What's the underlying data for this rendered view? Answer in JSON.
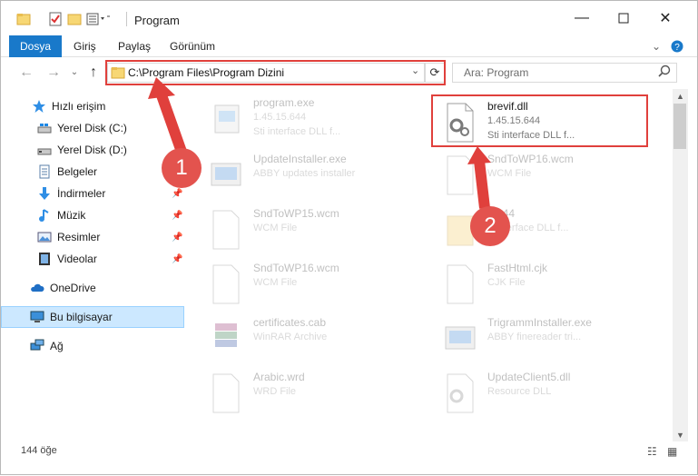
{
  "window": {
    "title": "Program"
  },
  "ribbon": {
    "tabs": [
      "Dosya",
      "Giriş",
      "Paylaş",
      "Görünüm"
    ],
    "help_icon": "question-icon"
  },
  "address": {
    "path": "C:\\Program Files\\Program Dizini"
  },
  "search": {
    "placeholder": "Ara: Program"
  },
  "sidebar": {
    "items": [
      {
        "label": "Hızlı erişim",
        "icon": "star-icon"
      },
      {
        "label": "Yerel Disk (C:)",
        "icon": "drive-icon",
        "pinned": true
      },
      {
        "label": "Yerel Disk (D:)",
        "icon": "drive-icon",
        "pinned": true
      },
      {
        "label": "Belgeler",
        "icon": "documents-icon",
        "pinned": true
      },
      {
        "label": "İndirmeler",
        "icon": "download-icon",
        "pinned": true
      },
      {
        "label": "Müzik",
        "icon": "music-icon",
        "pinned": true
      },
      {
        "label": "Resimler",
        "icon": "pictures-icon",
        "pinned": true
      },
      {
        "label": "Videolar",
        "icon": "video-icon",
        "pinned": true
      },
      {
        "label": "OneDrive",
        "icon": "cloud-icon"
      },
      {
        "label": "Bu bilgisayar",
        "icon": "computer-icon",
        "selected": true
      },
      {
        "label": "Ağ",
        "icon": "network-icon"
      }
    ]
  },
  "files": [
    {
      "name": "program.exe",
      "line1": "1.45.15.644",
      "line2": "Sti interface DLL f...",
      "icon": "exe-icon"
    },
    {
      "name": "brevif.dll",
      "line1": "1.45.15.644",
      "line2": "Sti interface DLL f...",
      "icon": "dll-gear-icon"
    },
    {
      "name": "UpdateInstaller.exe",
      "line1": "ABBY updates installer",
      "line2": "",
      "icon": "installer-icon"
    },
    {
      "name": "SndToWP16.wcm",
      "line1": "WCM File",
      "line2": "",
      "icon": "file-icon"
    },
    {
      "name": "SndToWP15.wcm",
      "line1": "WCM File",
      "line2": "",
      "icon": "file-icon"
    },
    {
      "name": "...644",
      "line1": "...interface DLL f...",
      "line2": "",
      "icon": "folder-file-icon"
    },
    {
      "name": "SndToWP16.wcm",
      "line1": "WCM File",
      "line2": "",
      "icon": "file-icon"
    },
    {
      "name": "FastHtml.cjk",
      "line1": "CJK File",
      "line2": "",
      "icon": "file-icon"
    },
    {
      "name": "certificates.cab",
      "line1": "WinRAR Archive",
      "line2": "",
      "icon": "archive-icon"
    },
    {
      "name": "TrigrammInstaller.exe",
      "line1": "ABBY finereader tri...",
      "line2": "",
      "icon": "installer-icon"
    },
    {
      "name": "Arabic.wrd",
      "line1": "WRD File",
      "line2": "",
      "icon": "file-icon"
    },
    {
      "name": "UpdateClient5.dll",
      "line1": "Resource DLL",
      "line2": "",
      "icon": "dll-gear-icon"
    }
  ],
  "status": {
    "count": "144 öğe"
  },
  "annotations": {
    "step1": "1",
    "step2": "2",
    "color": "#e0403c"
  }
}
